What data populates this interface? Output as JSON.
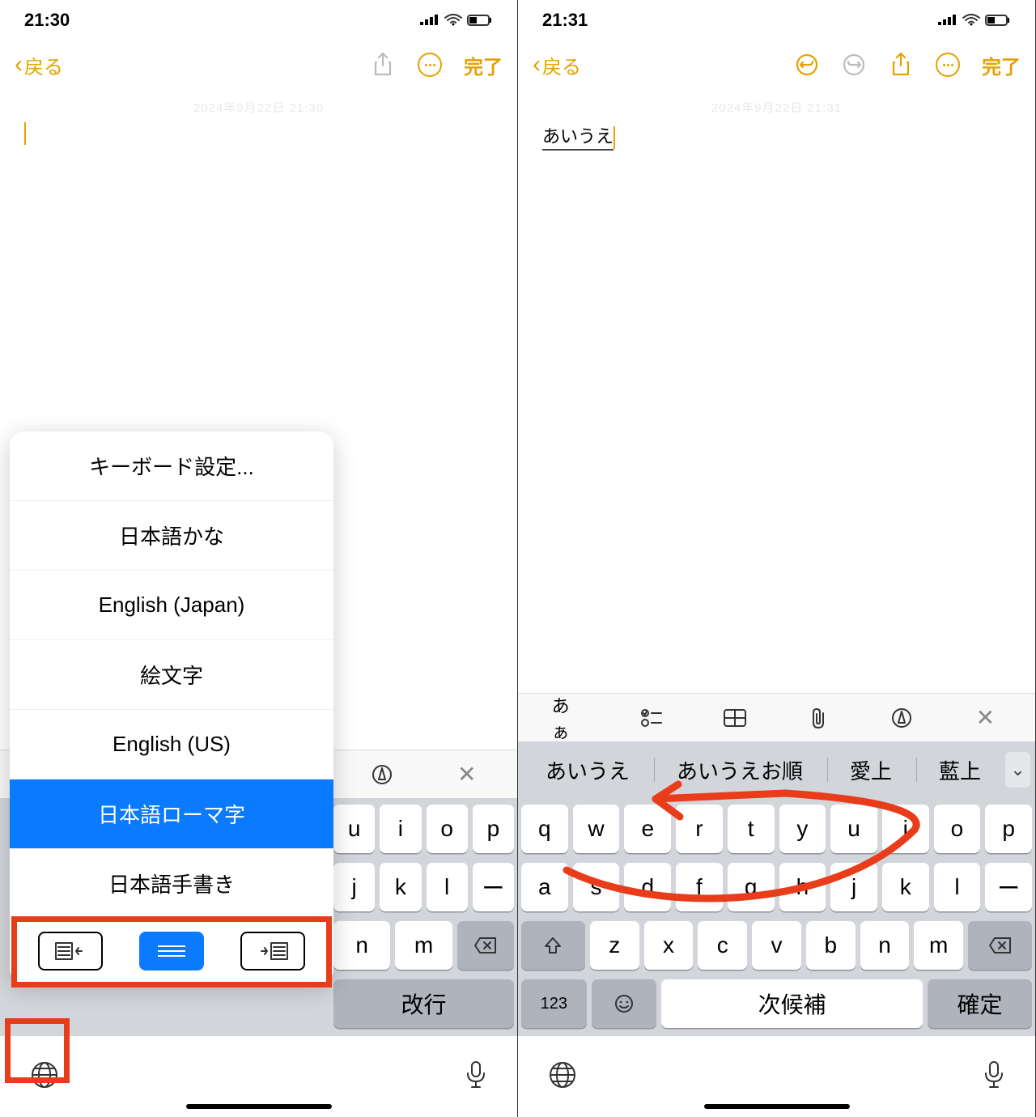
{
  "left": {
    "time": "21:30",
    "back": "戻る",
    "done": "完了",
    "date_faint": "2024年9月22日 21:30",
    "popup": {
      "settings": "キーボード設定...",
      "items": [
        "日本語かな",
        "English (Japan)",
        "絵文字",
        "English (US)",
        "日本語ローマ字",
        "日本語手書き"
      ],
      "selected": "日本語ローマ字"
    },
    "keys_r1_tail": [
      "u",
      "i",
      "o",
      "p"
    ],
    "keys_r2_tail": [
      "j",
      "k",
      "l",
      "ー"
    ],
    "keys_r3_tail": [
      "n",
      "m"
    ],
    "newline": "改行"
  },
  "right": {
    "time": "21:31",
    "back": "戻る",
    "done": "完了",
    "date_faint": "2024年9月22日 21:31",
    "note_text": "あいうえ",
    "toolbar_aa": "あぁ",
    "suggestions": [
      "あいうえ",
      "あいうえお順",
      "愛上",
      "藍上"
    ],
    "keys_r1": [
      "q",
      "w",
      "e",
      "r",
      "t",
      "y",
      "u",
      "i",
      "o",
      "p"
    ],
    "keys_r2": [
      "a",
      "s",
      "d",
      "f",
      "g",
      "h",
      "j",
      "k",
      "l",
      "ー"
    ],
    "keys_r3": [
      "z",
      "x",
      "c",
      "v",
      "b",
      "n",
      "m"
    ],
    "key_123": "123",
    "next_cand": "次候補",
    "confirm": "確定"
  }
}
